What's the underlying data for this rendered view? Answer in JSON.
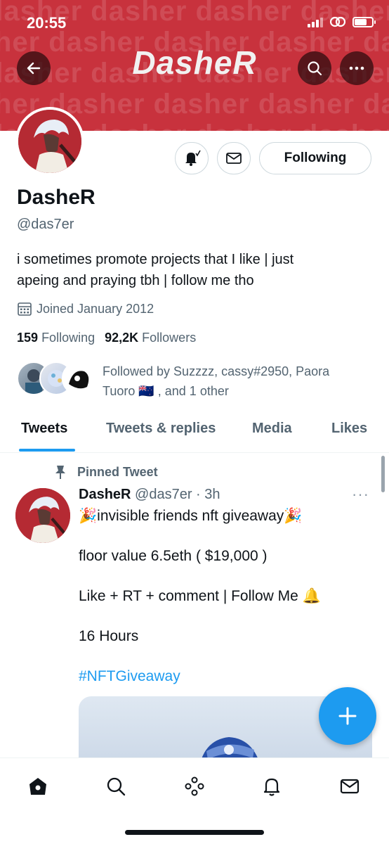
{
  "status_bar": {
    "time": "20:55"
  },
  "banner": {
    "title": "DasheR",
    "pattern_word": "dasher"
  },
  "profile": {
    "name": "DasheR",
    "handle": "@das7er",
    "bio_line1": "i sometimes promote projects that I like | just",
    "bio_line2": "apeing and praying tbh | follow me tho",
    "joined": "Joined January 2012",
    "following_count": "159",
    "following_label": "Following",
    "followers_count": "92,2K",
    "followers_label": "Followers",
    "followed_by_line1": "Followed by Suzzzz, cassy#2950, Paora",
    "followed_by_line2": "Tuoro 🇳🇿 , and 1 other",
    "following_button": "Following"
  },
  "tabs": [
    {
      "label": "Tweets",
      "active": true
    },
    {
      "label": "Tweets & replies",
      "active": false
    },
    {
      "label": "Media",
      "active": false
    },
    {
      "label": "Likes",
      "active": false
    }
  ],
  "tweet": {
    "pinned_label": "Pinned Tweet",
    "author": "DasheR",
    "handle_time": "@das7er · 3h",
    "more": "···",
    "line1": "🎉invisible friends nft giveaway🎉",
    "line2": "floor value 6.5eth ( $19,000 )",
    "line3": "Like + RT + comment | Follow Me 🔔",
    "line4": "16 Hours",
    "hashtag": "#NFTGiveaway"
  },
  "colors": {
    "banner": "#c8323d",
    "accent": "#1d9bf0",
    "text": "#0f1419",
    "muted": "#536471"
  },
  "icons": [
    "back-arrow-icon",
    "search-icon",
    "more-icon",
    "bell-icon",
    "mail-icon",
    "calendar-icon",
    "pin-icon",
    "plus-icon",
    "home-icon",
    "explore-icon",
    "spaces-icon",
    "notifications-icon",
    "messages-icon"
  ]
}
